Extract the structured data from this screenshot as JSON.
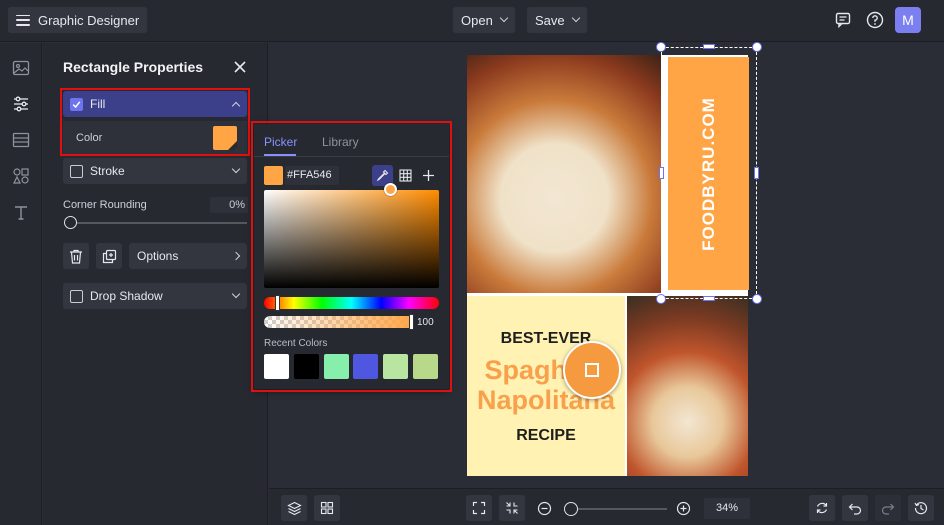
{
  "app": {
    "title": "Graphic Designer"
  },
  "topbar": {
    "open_label": "Open",
    "save_label": "Save",
    "avatar_initial": "M"
  },
  "panel": {
    "title": "Rectangle Properties",
    "fill": {
      "label": "Fill",
      "checked": true,
      "color_label": "Color",
      "color": "#FFA546"
    },
    "stroke": {
      "label": "Stroke",
      "checked": false
    },
    "corner_rounding": {
      "label": "Corner Rounding",
      "value": "0%",
      "slider_fraction": 0
    },
    "options_label": "Options",
    "drop_shadow": {
      "label": "Drop Shadow",
      "checked": false
    }
  },
  "picker": {
    "tabs": [
      "Picker",
      "Library"
    ],
    "active_tab": "Picker",
    "hex": "#FFA546",
    "alpha": "100",
    "recent_label": "Recent Colors",
    "recent_colors": [
      "#FFFFFF",
      "#000000",
      "#86EFAC",
      "#4F57E0",
      "#B8E6A0",
      "#B9D98A"
    ]
  },
  "canvas": {
    "banner_text": "FOODBYRU.COM",
    "headline_top": "BEST-EVER",
    "headline_main_1": "Spaghetti",
    "headline_main_2": "Napolitana",
    "headline_bottom": "RECIPE"
  },
  "bottombar": {
    "zoom": "34%",
    "zoom_fraction": 0.0
  },
  "colors": {
    "accent": "#6D74EE",
    "highlight": "#E01010",
    "brand_orange": "#FFA546"
  }
}
